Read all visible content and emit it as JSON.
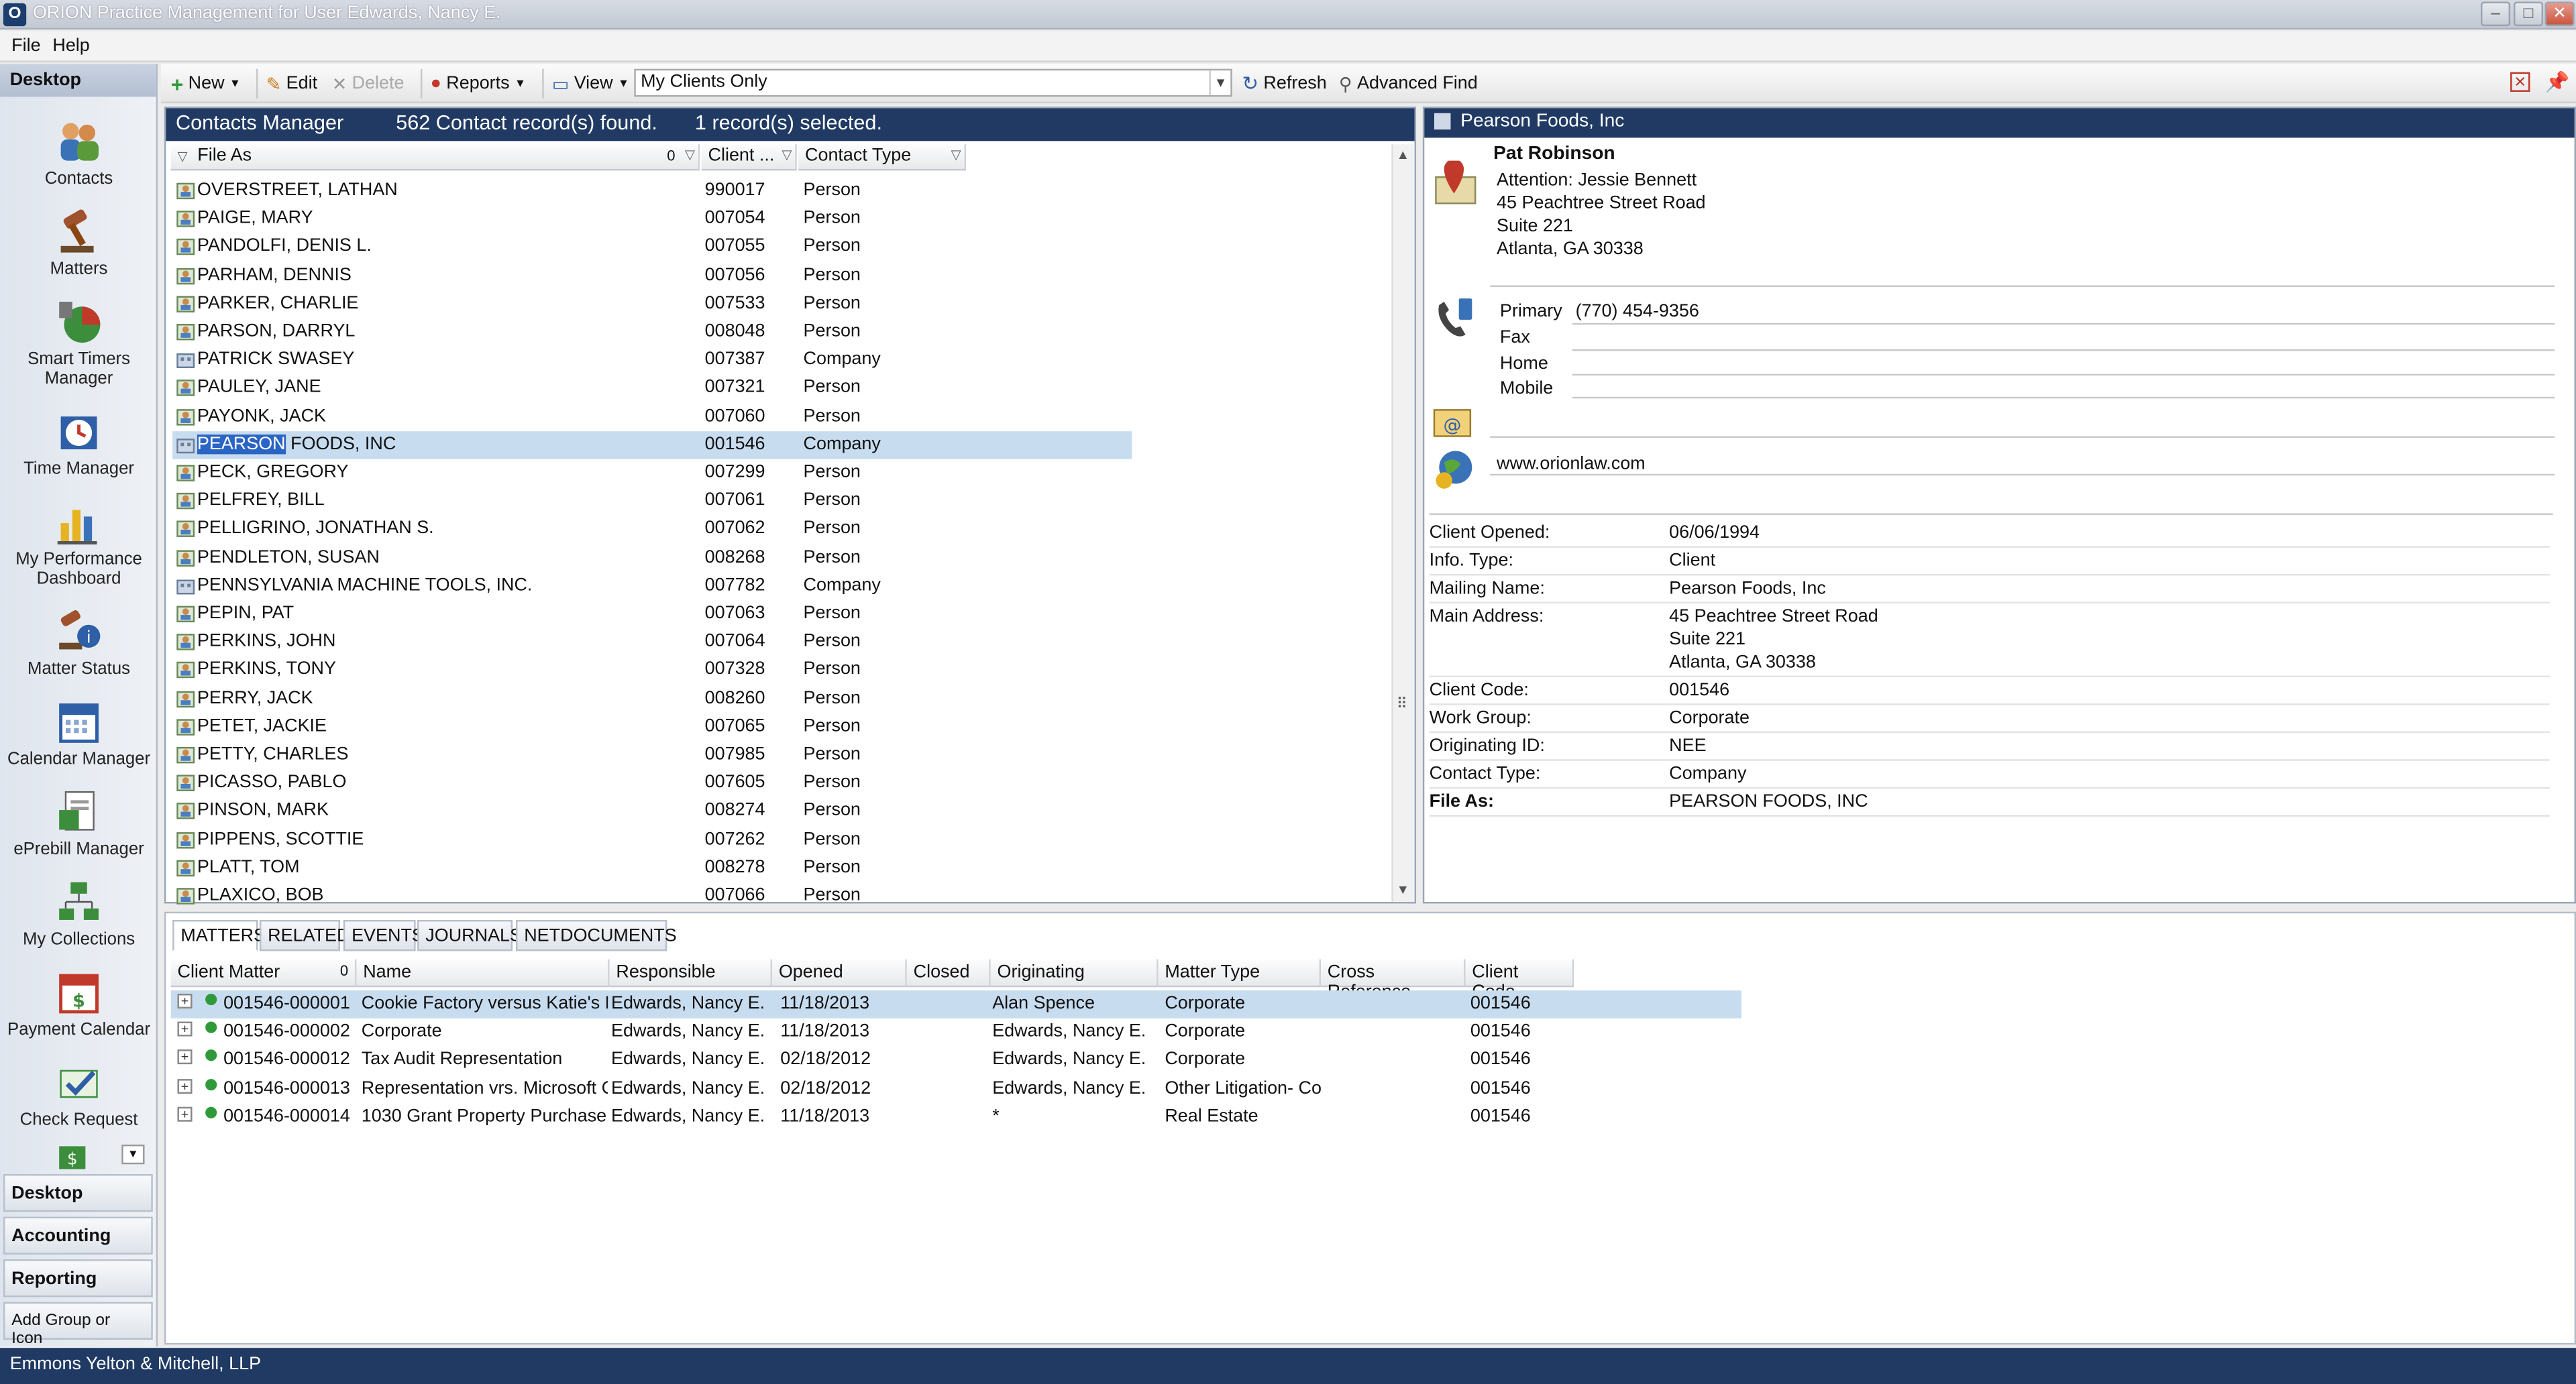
{
  "window": {
    "title": "ORION Practice Management for User Edwards, Nancy E.",
    "minimize": "–",
    "maximize": "□",
    "close": "✕"
  },
  "menu": [
    "File",
    "Help"
  ],
  "nav": {
    "header": "Desktop",
    "items": [
      {
        "label": "Contacts",
        "icon": "contacts-icon"
      },
      {
        "label": "Matters",
        "icon": "gavel-icon"
      },
      {
        "label": "Smart Timers Manager",
        "icon": "pie-chart-icon"
      },
      {
        "label": "Time Manager",
        "icon": "clock-icon"
      },
      {
        "label": "My Performance Dashboard",
        "icon": "bar-chart-icon"
      },
      {
        "label": "Matter Status",
        "icon": "info-icon"
      },
      {
        "label": "Calendar Manager",
        "icon": "calendar-icon"
      },
      {
        "label": "ePrebill Manager",
        "icon": "document-icon"
      },
      {
        "label": "My Collections",
        "icon": "org-chart-icon"
      },
      {
        "label": "Payment Calendar",
        "icon": "calendar-money-icon"
      },
      {
        "label": "Check Request",
        "icon": "check-icon"
      }
    ],
    "groups": [
      "Desktop",
      "Accounting",
      "Reporting"
    ],
    "add_group": "Add Group or Icon"
  },
  "toolbar": {
    "new": "New",
    "edit": "Edit",
    "delete": "Delete",
    "reports": "Reports",
    "view": "View",
    "view_filter": "My Clients Only",
    "refresh": "Refresh",
    "advanced_find": "Advanced Find"
  },
  "contacts": {
    "title": "Contacts Manager",
    "count": "562 Contact record(s) found.",
    "selected": "1 record(s) selected.",
    "columns": {
      "file_as": "File As",
      "file_as_sort": "0",
      "client": "Client ...",
      "contact_type": "Contact Type"
    },
    "rows": [
      {
        "file_as": "OVERSTREET, LATHAN",
        "client": "990017",
        "type": "Person"
      },
      {
        "file_as": "PAIGE, MARY",
        "client": "007054",
        "type": "Person"
      },
      {
        "file_as": "PANDOLFI, DENIS L.",
        "client": "007055",
        "type": "Person"
      },
      {
        "file_as": "PARHAM, DENNIS",
        "client": "007056",
        "type": "Person"
      },
      {
        "file_as": "PARKER, CHARLIE",
        "client": "007533",
        "type": "Person"
      },
      {
        "file_as": "PARSON, DARRYL",
        "client": "008048",
        "type": "Person"
      },
      {
        "file_as": "PATRICK SWASEY",
        "client": "007387",
        "type": "Company"
      },
      {
        "file_as": "PAULEY, JANE",
        "client": "007321",
        "type": "Person"
      },
      {
        "file_as": "PAYONK, JACK",
        "client": "007060",
        "type": "Person"
      },
      {
        "file_as": "FOODS, INC",
        "file_as_highlight": "PEARSON",
        "client": "001546",
        "type": "Company",
        "selected": true
      },
      {
        "file_as": "PECK, GREGORY",
        "client": "007299",
        "type": "Person"
      },
      {
        "file_as": "PELFREY, BILL",
        "client": "007061",
        "type": "Person"
      },
      {
        "file_as": "PELLIGRINO, JONATHAN S.",
        "client": "007062",
        "type": "Person"
      },
      {
        "file_as": "PENDLETON, SUSAN",
        "client": "008268",
        "type": "Person"
      },
      {
        "file_as": "PENNSYLVANIA MACHINE TOOLS, INC.",
        "client": "007782",
        "type": "Company"
      },
      {
        "file_as": "PEPIN, PAT",
        "client": "007063",
        "type": "Person"
      },
      {
        "file_as": "PERKINS, JOHN",
        "client": "007064",
        "type": "Person"
      },
      {
        "file_as": "PERKINS, TONY",
        "client": "007328",
        "type": "Person"
      },
      {
        "file_as": "PERRY, JACK",
        "client": "008260",
        "type": "Person"
      },
      {
        "file_as": "PETET, JACKIE",
        "client": "007065",
        "type": "Person"
      },
      {
        "file_as": "PETTY, CHARLES",
        "client": "007985",
        "type": "Person"
      },
      {
        "file_as": "PICASSO, PABLO",
        "client": "007605",
        "type": "Person"
      },
      {
        "file_as": "PINSON, MARK",
        "client": "008274",
        "type": "Person"
      },
      {
        "file_as": "PIPPENS, SCOTTIE",
        "client": "007262",
        "type": "Person"
      },
      {
        "file_as": "PLATT, TOM",
        "client": "008278",
        "type": "Person"
      },
      {
        "file_as": "PLAXICO, BOB",
        "client": "007066",
        "type": "Person"
      }
    ]
  },
  "detail": {
    "header": "Pearson Foods, Inc",
    "contact_name": "Pat Robinson",
    "address": [
      "Attention: Jessie Bennett",
      "45 Peachtree Street Road",
      "Suite 221",
      "Atlanta, GA 30338"
    ],
    "phones": [
      {
        "label": "Primary",
        "value": "(770) 454-9356"
      },
      {
        "label": "Fax",
        "value": ""
      },
      {
        "label": "Home",
        "value": ""
      },
      {
        "label": "Mobile",
        "value": ""
      }
    ],
    "email": "",
    "website": "www.orionlaw.com",
    "fields": [
      {
        "label": "Client Opened:",
        "value": "06/06/1994"
      },
      {
        "label": "Info. Type:",
        "value": "Client"
      },
      {
        "label": "Mailing Name:",
        "value": "Pearson Foods, Inc"
      },
      {
        "label": "Main Address:",
        "value": "45 Peachtree Street Road",
        "extra": [
          "Suite 221",
          "Atlanta, GA 30338"
        ]
      },
      {
        "label": "Client Code:",
        "value": "001546"
      },
      {
        "label": "Work Group:",
        "value": "Corporate"
      },
      {
        "label": "Originating ID:",
        "value": "NEE"
      },
      {
        "label": "Contact Type:",
        "value": "Company"
      },
      {
        "label": "File As:",
        "value": "PEARSON FOODS, INC",
        "bold_label": true
      }
    ]
  },
  "bottom": {
    "tabs": [
      "MATTERS",
      "RELATED",
      "EVENTS",
      "JOURNALS",
      "NETDOCUMENTS"
    ],
    "active_tab": "MATTERS",
    "columns": [
      "Client Matter",
      "Name",
      "Responsible",
      "Opened",
      "Closed",
      "Originating",
      "Matter Type",
      "Cross Reference",
      "Client Code"
    ],
    "client_matter_sort": "0",
    "rows": [
      {
        "matter": "001546-000001",
        "name": "Cookie Factory versus Katie's B",
        "responsible": "Edwards, Nancy E.",
        "opened": "11/18/2013",
        "closed": "",
        "originating": "Alan Spence",
        "type": "Corporate",
        "xref": "",
        "code": "001546",
        "selected": true
      },
      {
        "matter": "001546-000002",
        "name": "Corporate",
        "responsible": "Edwards, Nancy E.",
        "opened": "11/18/2013",
        "closed": "",
        "originating": "Edwards, Nancy E.",
        "type": "Corporate",
        "xref": "",
        "code": "001546"
      },
      {
        "matter": "001546-000012",
        "name": "Tax Audit Representation",
        "responsible": "Edwards, Nancy E.",
        "opened": "02/18/2012",
        "closed": "",
        "originating": "Edwards, Nancy E.",
        "type": "Corporate",
        "xref": "",
        "code": "001546"
      },
      {
        "matter": "001546-000013",
        "name": "Representation vrs. Microsoft C",
        "responsible": "Edwards, Nancy E.",
        "opened": "02/18/2012",
        "closed": "",
        "originating": "Edwards, Nancy E.",
        "type": "Other Litigation- Co",
        "xref": "",
        "code": "001546"
      },
      {
        "matter": "001546-000014",
        "name": "1030 Grant Property Purchase",
        "responsible": "Edwards, Nancy E.",
        "opened": "11/18/2013",
        "closed": "",
        "originating": "*",
        "type": "Real Estate",
        "xref": "",
        "code": "001546"
      }
    ]
  },
  "status": "Emmons Yelton & Mitchell, LLP",
  "colors": {
    "header_navy": "#203a63",
    "selection": "#c8dcf0",
    "highlight": "#2a64c4"
  }
}
